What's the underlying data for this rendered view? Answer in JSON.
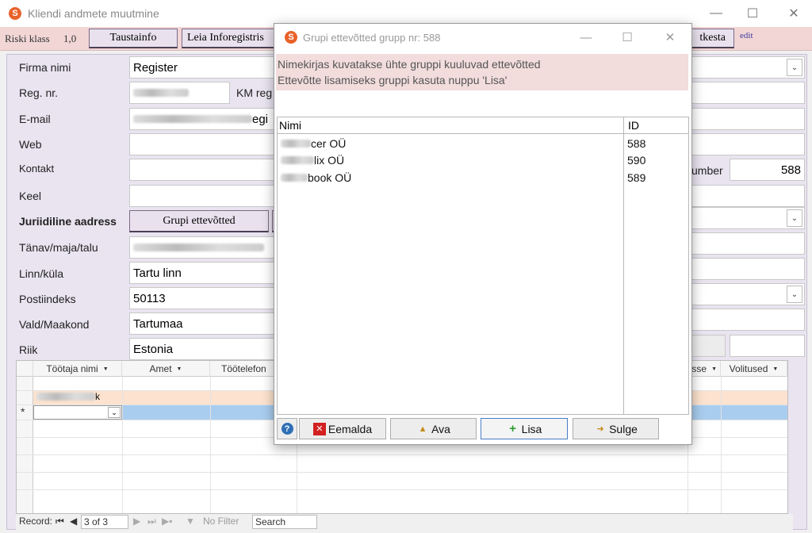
{
  "window": {
    "title": "Kliendi andmete muutmine"
  },
  "risk": {
    "label": "Riski klass",
    "value": "1,0"
  },
  "toolbar": {
    "background_info": "Taustainfo",
    "find_inforegister": "Leia Inforegistris",
    "close": "tkesta",
    "edit": "edit"
  },
  "form": {
    "company_name_label": "Firma nimi",
    "company_name": "Register",
    "reg_nr_label": "Reg. nr.",
    "km_label": "KM reg",
    "email_label": "E-mail",
    "email_suffix": "egi",
    "web_label": "Web",
    "contact_label": "Kontakt",
    "number_label": "umber",
    "number_value": "588",
    "language_label": "Keel",
    "legal_address_label": "Juriidiline aadress",
    "group_companies_button": "Grupi ettevõtted",
    "street_label": "Tänav/maja/talu",
    "city_label": "Linn/küla",
    "city": "Tartu linn",
    "postal_label": "Postiindeks",
    "postal": "50113",
    "county_label": "Vald/Maakond",
    "county": "Tartumaa",
    "country_label": "Riik",
    "country": "Estonia"
  },
  "employees": {
    "columns": [
      "Töötaja nimi",
      "Amet",
      "Töötelefon",
      "sse",
      "Volitused"
    ],
    "row_suffix": "k",
    "new_row_marker": "*"
  },
  "record_nav": {
    "label": "Record:",
    "position": "3 of 3",
    "filter": "No Filter",
    "search": "Search"
  },
  "dialog": {
    "title": "Grupi ettevõtted grupp nr: 588",
    "info_line1": "Nimekirjas kuvatakse ühte gruppi kuuluvad ettevõtted",
    "info_line2": "Ettevõtte lisamiseks gruppi kasuta nuppu 'Lisa'",
    "col_name": "Nimi",
    "col_id": "ID",
    "rows": [
      {
        "name": "cer OÜ",
        "id": "588"
      },
      {
        "name": "lix OÜ",
        "id": "590"
      },
      {
        "name": "book OÜ",
        "id": "589"
      }
    ],
    "buttons": {
      "help": "?",
      "remove": "Eemalda",
      "open": "Ava",
      "add": "Lisa",
      "close": "Sulge"
    }
  },
  "colors": {
    "accent": "#e8622a",
    "info_bg": "#f2dcdc",
    "form_bg": "#e9e4f0",
    "row_selected": "#a9cdef",
    "row_current": "#fde3cf"
  }
}
